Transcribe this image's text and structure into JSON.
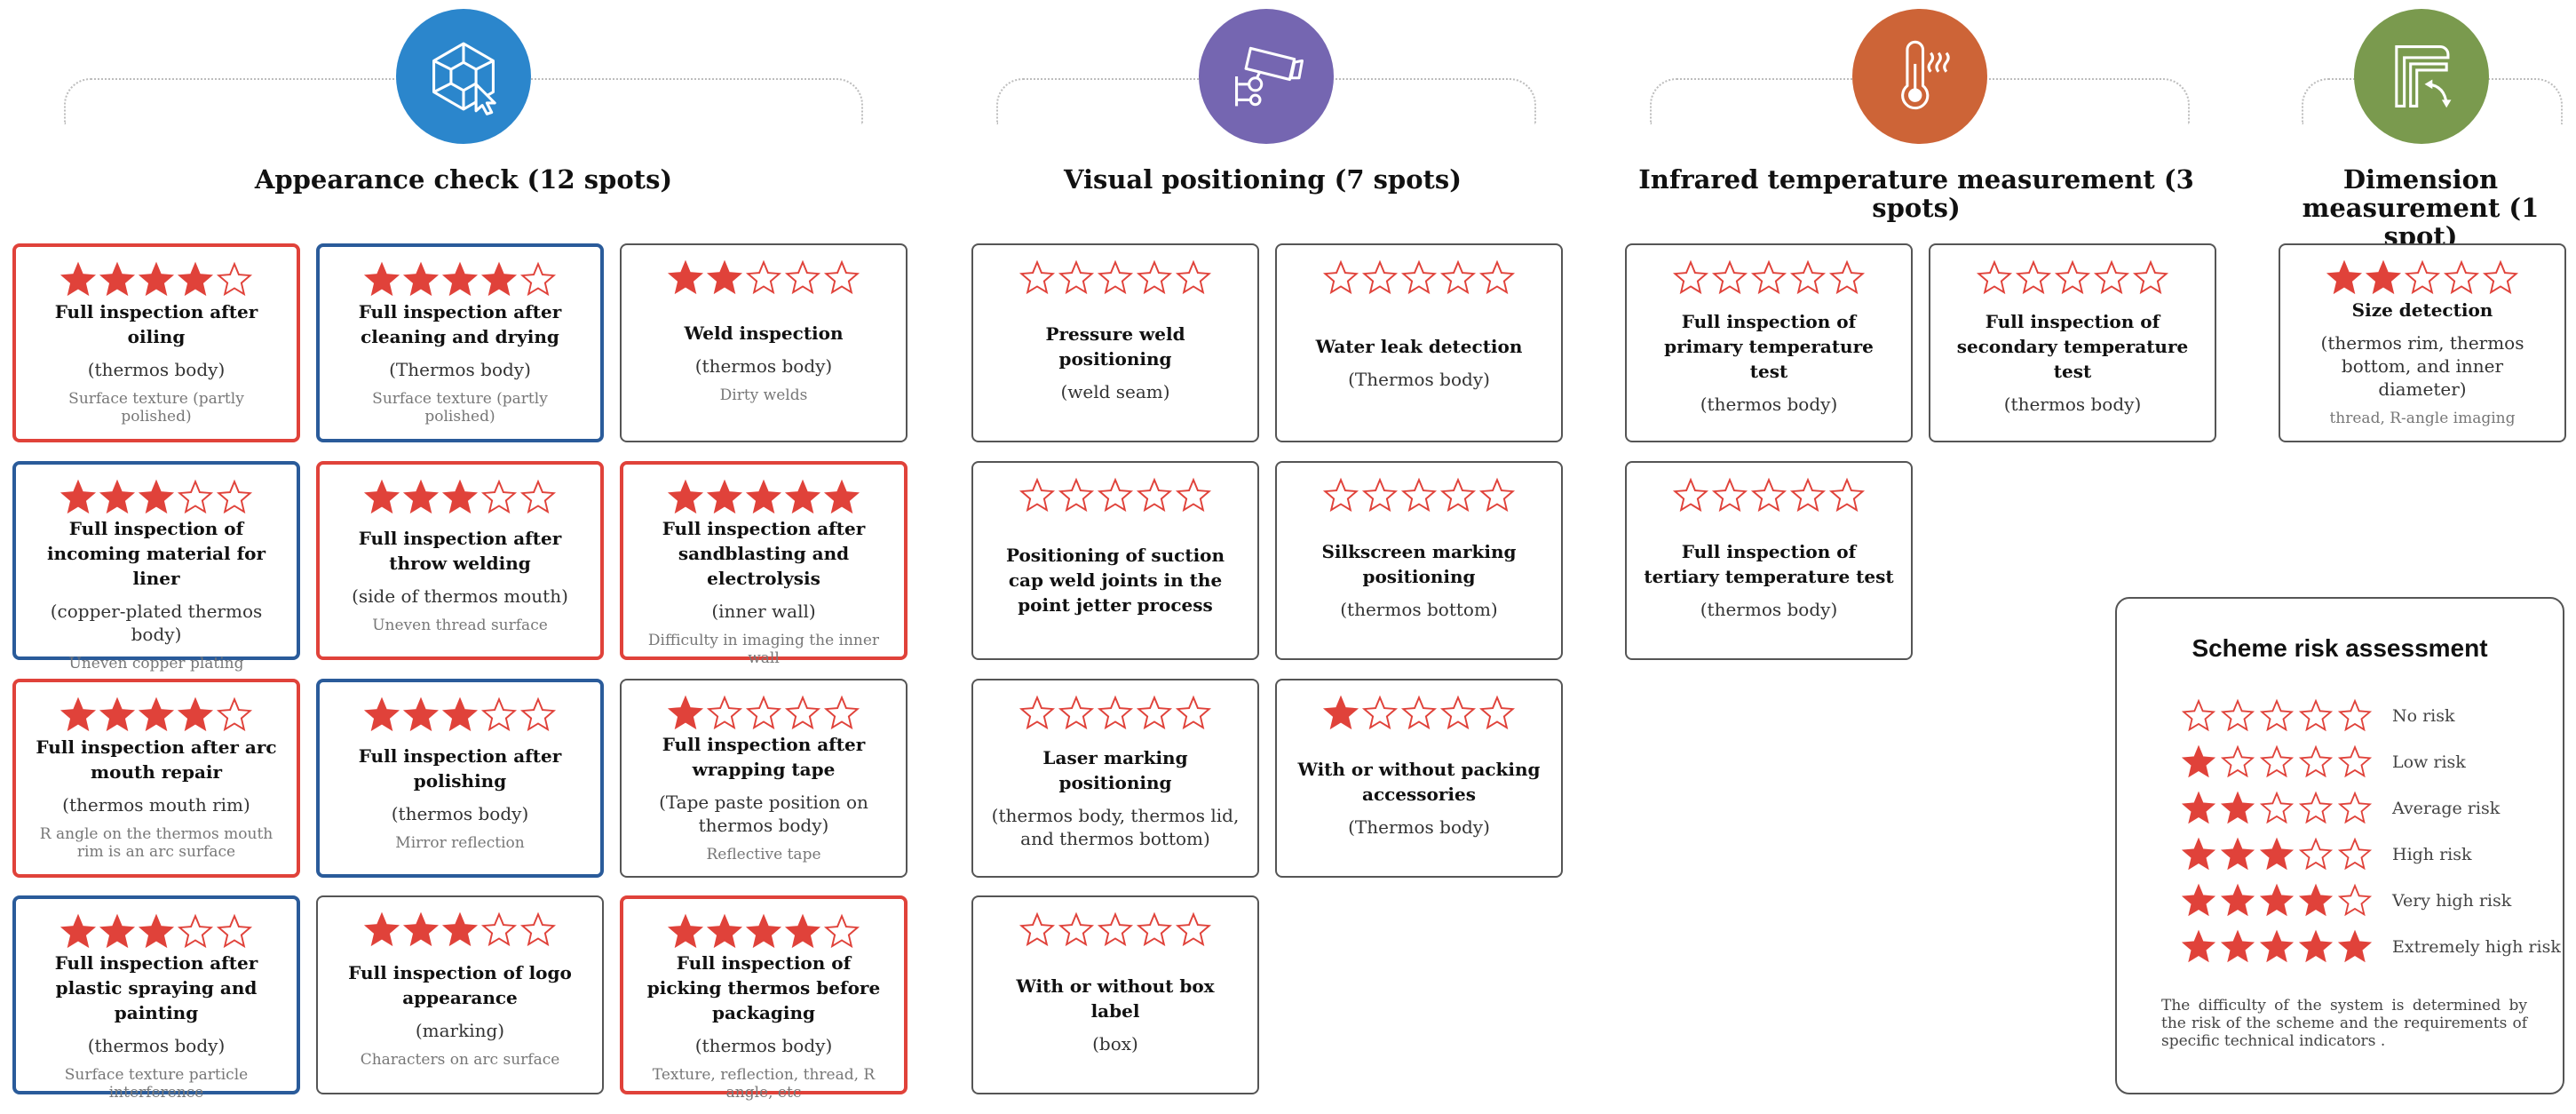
{
  "colors": {
    "star": "#e0423a",
    "red_border": "#e0423a",
    "blue_border": "#2a5b9a"
  },
  "sections": [
    {
      "title": "Appearance check (12 spots)",
      "icon": "cube-cursor-icon",
      "color": "#2b86cc"
    },
    {
      "title": "Visual positioning (7 spots)",
      "icon": "camera-icon",
      "color": "#7566b1"
    },
    {
      "title": "Infrared temperature measurement (3 spots)",
      "icon": "thermometer-icon",
      "color": "#cd6437"
    },
    {
      "title": "Dimension measurement (1 spot)",
      "icon": "dimension-icon",
      "color": "#7a9a4e"
    }
  ],
  "cards": [
    {
      "rating": 4,
      "border": "red",
      "title": "Full inspection after oiling",
      "sub": "(thermos body)",
      "note": "Surface texture (partly polished)"
    },
    {
      "rating": 4,
      "border": "blue",
      "title": "Full inspection after cleaning and drying",
      "sub": "(Thermos body)",
      "note": "Surface texture (partly polished)"
    },
    {
      "rating": 2,
      "border": "gray",
      "title": "Weld inspection",
      "sub": "(thermos body)",
      "note": "Dirty welds"
    },
    {
      "rating": 3,
      "border": "blue",
      "title": "Full inspection of incoming material for liner",
      "sub": "(copper-plated thermos body)",
      "note": "Uneven copper plating"
    },
    {
      "rating": 3,
      "border": "red",
      "title": "Full inspection after throw welding",
      "sub": "(side of thermos mouth)",
      "note": "Uneven thread surface"
    },
    {
      "rating": 5,
      "border": "red",
      "title": "Full inspection after sandblasting and electrolysis",
      "sub": "(inner wall)",
      "note": "Difficulty in imaging the inner wall"
    },
    {
      "rating": 4,
      "border": "red",
      "title": "Full inspection after arc mouth repair",
      "sub": "(thermos mouth rim)",
      "note": "R angle on the thermos mouth rim is an arc surface"
    },
    {
      "rating": 3,
      "border": "blue",
      "title": "Full inspection after polishing",
      "sub": "(thermos body)",
      "note": "Mirror reflection"
    },
    {
      "rating": 1,
      "border": "gray",
      "title": "Full inspection after wrapping tape",
      "sub": "(Tape paste position on thermos body)",
      "note": "Reflective tape"
    },
    {
      "rating": 3,
      "border": "blue",
      "title": "Full inspection after plastic spraying and painting",
      "sub": "(thermos body)",
      "note": "Surface texture particle interference"
    },
    {
      "rating": 3,
      "border": "gray",
      "title": "Full inspection of logo appearance",
      "sub": "(marking)",
      "note": "Characters on arc surface"
    },
    {
      "rating": 4,
      "border": "red",
      "title": "Full inspection of picking thermos before packaging",
      "sub": "(thermos body)",
      "note": "Texture, reflection, thread, R angle, etc"
    },
    {
      "rating": 0,
      "border": "gray",
      "title": "Pressure weld positioning",
      "sub": "(weld seam)",
      "note": ""
    },
    {
      "rating": 0,
      "border": "gray",
      "title": "Water leak detection",
      "sub": "(Thermos body)",
      "note": ""
    },
    {
      "rating": 0,
      "border": "gray",
      "title": "Positioning of suction cap weld joints in the point jetter process",
      "sub": "",
      "note": ""
    },
    {
      "rating": 0,
      "border": "gray",
      "title": "Silkscreen marking positioning",
      "sub": "(thermos bottom)",
      "note": ""
    },
    {
      "rating": 0,
      "border": "gray",
      "title": "Laser marking positioning",
      "sub": "(thermos body, thermos lid, and thermos bottom)",
      "note": ""
    },
    {
      "rating": 1,
      "border": "gray",
      "title": "With or without packing accessories",
      "sub": "(Thermos body)",
      "note": ""
    },
    {
      "rating": 0,
      "border": "gray",
      "title": "With or without box label",
      "sub": "(box)",
      "note": ""
    },
    {
      "rating": 0,
      "border": "gray",
      "title": "Full inspection of primary temperature test",
      "sub": "(thermos body)",
      "note": ""
    },
    {
      "rating": 0,
      "border": "gray",
      "title": "Full inspection of secondary temperature test",
      "sub": "(thermos body)",
      "note": ""
    },
    {
      "rating": 0,
      "border": "gray",
      "title": "Full inspection of tertiary temperature test",
      "sub": "(thermos body)",
      "note": ""
    },
    {
      "rating": 2,
      "border": "gray",
      "title": "Size detection",
      "sub": "(thermos rim, thermos bottom, and inner diameter)",
      "note": "thread, R-angle imaging"
    }
  ],
  "legend": {
    "title": "Scheme risk assessment",
    "items": [
      {
        "rating": 0,
        "label": "No risk"
      },
      {
        "rating": 1,
        "label": "Low risk"
      },
      {
        "rating": 2,
        "label": "Average risk"
      },
      {
        "rating": 3,
        "label": "High risk"
      },
      {
        "rating": 4,
        "label": "Very high risk"
      },
      {
        "rating": 5,
        "label": "Extremely high risk"
      }
    ],
    "description": "The difficulty of the system is determined by the risk of the scheme and the requirements of specific technical indicators ."
  }
}
